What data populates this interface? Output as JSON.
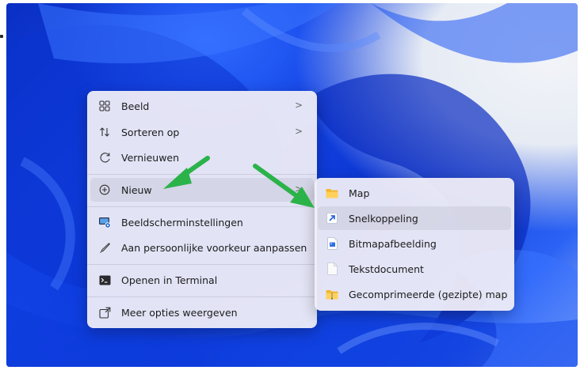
{
  "main_menu": {
    "items": [
      {
        "label": "Beeld",
        "icon": "grid-icon",
        "has_submenu": true
      },
      {
        "label": "Sorteren op",
        "icon": "sort-icon",
        "has_submenu": true
      },
      {
        "label": "Vernieuwen",
        "icon": "refresh-icon",
        "has_submenu": false
      },
      {
        "label": "Nieuw",
        "icon": "new-plus-icon",
        "has_submenu": true
      },
      {
        "label": "Beeldscherminstellingen",
        "icon": "display-settings-icon",
        "has_submenu": false
      },
      {
        "label": "Aan persoonlijke voorkeur aanpassen",
        "icon": "brush-icon",
        "has_submenu": false
      },
      {
        "label": "Openen in Terminal",
        "icon": "terminal-icon",
        "has_submenu": false
      },
      {
        "label": "Meer opties weergeven",
        "icon": "more-options-icon",
        "has_submenu": false
      }
    ],
    "chevron": ">"
  },
  "sub_menu": {
    "items": [
      {
        "label": "Map",
        "icon": "folder-icon"
      },
      {
        "label": "Snelkoppeling",
        "icon": "shortcut-icon"
      },
      {
        "label": "Bitmapafbeelding",
        "icon": "bitmap-file-icon"
      },
      {
        "label": "Tekstdocument",
        "icon": "text-document-icon"
      },
      {
        "label": "Gecomprimeerde (gezipte) map",
        "icon": "zip-folder-icon"
      }
    ]
  },
  "colors": {
    "arrow_green": "#2bb34a",
    "menu_bg": "#f0eef6",
    "wallpaper_blue": "#1446e8"
  }
}
